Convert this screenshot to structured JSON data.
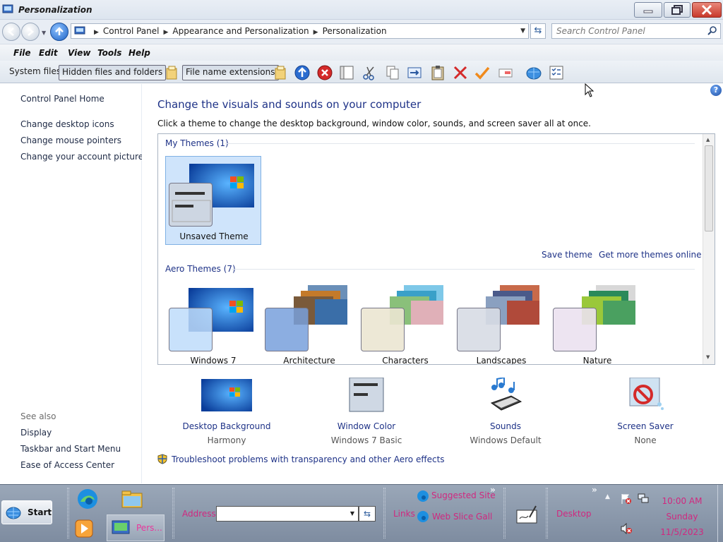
{
  "window": {
    "title": "Personalization"
  },
  "address": {
    "crumbs": [
      "Control Panel",
      "Appearance and Personalization",
      "Personalization"
    ],
    "search_placeholder": "Search Control Panel"
  },
  "menu": [
    "File",
    "Edit",
    "View",
    "Tools",
    "Help"
  ],
  "toolbar": {
    "system_files": "System files",
    "hidden_files": "Hidden files and folders",
    "file_name_extensions": "File name extensions",
    "icons": [
      "folder-options-icon",
      "up-arrow-icon",
      "stop-icon",
      "preview-pane-icon",
      "cut-icon",
      "copy-icon",
      "move-to-icon",
      "paste-icon",
      "delete-icon",
      "check-icon",
      "rename-icon",
      "shell-icon",
      "properties-icon"
    ]
  },
  "left": {
    "home": "Control Panel Home",
    "links": [
      "Change desktop icons",
      "Change mouse pointers",
      "Change your account picture"
    ],
    "see_also_label": "See also",
    "see_also": [
      "Display",
      "Taskbar and Start Menu",
      "Ease of Access Center"
    ]
  },
  "main": {
    "heading": "Change the visuals and sounds on your computer",
    "instructions": "Click a theme to change the desktop background, window color, sounds, and screen saver all at once.",
    "my_themes_label": "My Themes (1)",
    "unsaved_theme": "Unsaved Theme",
    "save_theme": "Save theme",
    "get_more_themes": "Get more themes online",
    "aero_themes_label": "Aero Themes (7)",
    "aero_themes": [
      "Windows 7",
      "Architecture",
      "Characters",
      "Landscapes",
      "Nature"
    ],
    "bottom": [
      {
        "title": "Desktop Background",
        "sub": "Harmony"
      },
      {
        "title": "Window Color",
        "sub": "Windows 7 Basic"
      },
      {
        "title": "Sounds",
        "sub": "Windows Default"
      },
      {
        "title": "Screen Saver",
        "sub": "None"
      }
    ],
    "troubleshoot": "Troubleshoot problems with transparency and other Aero effects"
  },
  "taskbar": {
    "start": "Start",
    "task_label": "Pers...",
    "address_label": "Address",
    "links_label": "Links",
    "suggested_sites": "Suggested Site",
    "web_slice": "Web Slice Gall",
    "desktop_label": "Desktop",
    "time": "10:00 AM",
    "day": "Sunday",
    "date": "11/5/2023"
  },
  "colors": {
    "link": "#1e3287",
    "tray_text": "#d0287f",
    "selection": "#cfe4fb"
  }
}
